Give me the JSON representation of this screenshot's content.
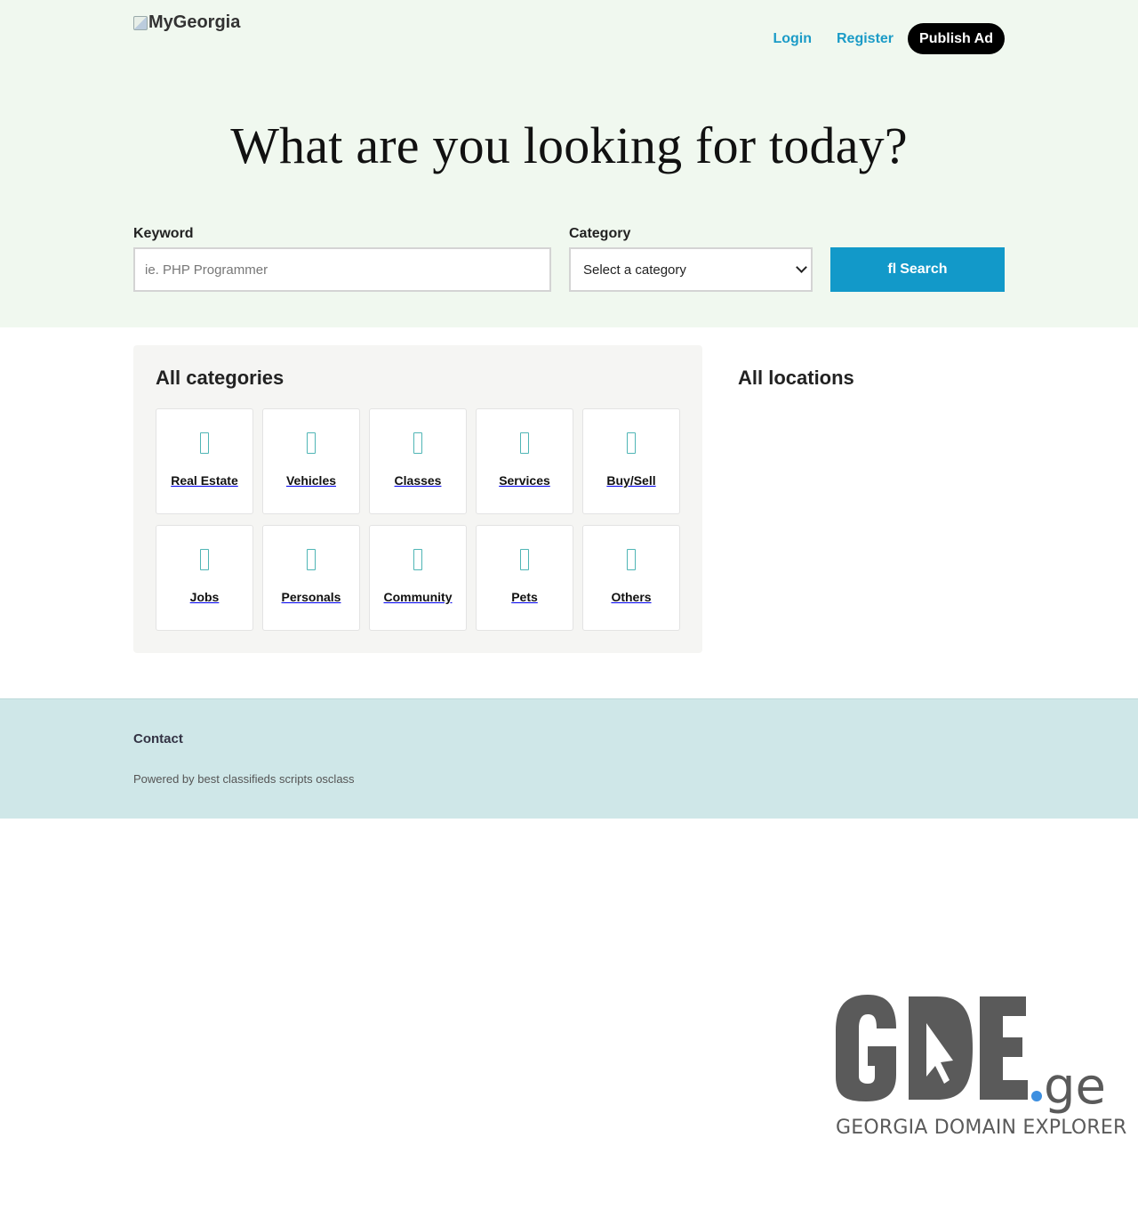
{
  "header": {
    "logo_alt": "MyGeorgia",
    "nav": {
      "login": "Login",
      "register": "Register",
      "publish": "Publish Ad"
    }
  },
  "hero": {
    "headline": "What are you looking for today?"
  },
  "search": {
    "keyword_label": "Keyword",
    "keyword_placeholder": "ie. PHP Programmer",
    "category_label": "Category",
    "category_selected": "Select a category",
    "button_label": "Search",
    "button_icon": "search-icon"
  },
  "categories": {
    "title": "All categories",
    "items": [
      {
        "label": "Real Estate",
        "icon": "category-icon"
      },
      {
        "label": "Vehicles",
        "icon": "category-icon"
      },
      {
        "label": "Classes",
        "icon": "category-icon"
      },
      {
        "label": "Services",
        "icon": "category-icon"
      },
      {
        "label": "Buy/Sell",
        "icon": "category-icon"
      },
      {
        "label": "Jobs",
        "icon": "category-icon"
      },
      {
        "label": "Personals",
        "icon": "category-icon"
      },
      {
        "label": "Community",
        "icon": "category-icon"
      },
      {
        "label": "Pets",
        "icon": "category-icon"
      },
      {
        "label": "Others",
        "icon": "category-icon"
      }
    ]
  },
  "locations": {
    "title": "All locations"
  },
  "footer": {
    "contact": "Contact",
    "powered": "Powered by best classifieds scripts osclass"
  },
  "branding": {
    "gde_logo": "GDE",
    "gde_suffix": ".ge",
    "gde_tagline": "GEORGIA DOMAIN EXPLORER"
  },
  "colors": {
    "hero_bg": "#f0f8ef",
    "accent": "#1299c9",
    "link": "#1b9bc7",
    "footer_bg": "#cfe7e8",
    "publish_bg": "#000000"
  }
}
